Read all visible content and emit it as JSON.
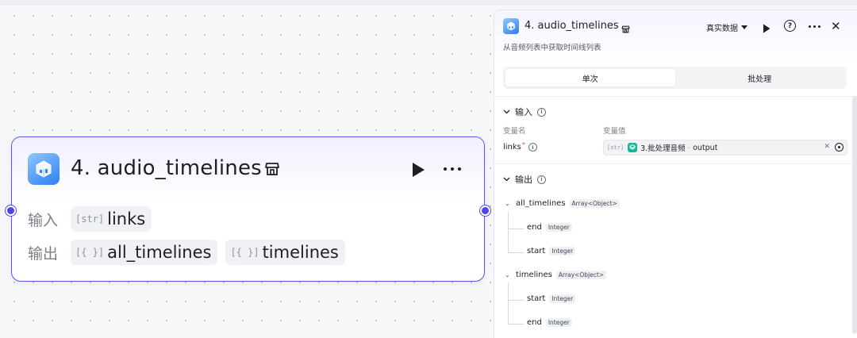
{
  "node": {
    "title": "4. audio_timelines",
    "icon": "node-cube-icon",
    "input_label": "输入",
    "output_label": "输出",
    "input_chips": [
      {
        "type": "[str]",
        "name": "links"
      }
    ],
    "output_chips": [
      {
        "type": "[{ }]",
        "name": "all_timelines"
      },
      {
        "type": "[{ }]",
        "name": "timelines"
      }
    ]
  },
  "panel": {
    "title": "4. audio_timelines",
    "description": "从音频列表中获取时间线列表",
    "data_select": "真实数据",
    "tabs": [
      {
        "label": "单次",
        "active": true
      },
      {
        "label": "批处理",
        "active": false
      }
    ],
    "input_section": {
      "title": "输入",
      "col_name": "变量名",
      "col_value": "变量值",
      "param": {
        "name": "links",
        "required_mark": "*",
        "type_tag": "[str]",
        "ref_node": "3.批处理音频",
        "ref_sep": "-",
        "ref_field": "output"
      }
    },
    "output_section": {
      "title": "输出",
      "fields": [
        {
          "name": "all_timelines",
          "type": "Array<Object>",
          "children": [
            {
              "name": "end",
              "type": "Integer"
            },
            {
              "name": "start",
              "type": "Integer"
            }
          ]
        },
        {
          "name": "timelines",
          "type": "Array<Object>",
          "children": [
            {
              "name": "start",
              "type": "Integer"
            },
            {
              "name": "end",
              "type": "Integer"
            }
          ]
        }
      ]
    }
  },
  "colors": {
    "accent": "#4f46e5",
    "node_border": "#5b54e6",
    "ref_icon": "#17b897"
  }
}
